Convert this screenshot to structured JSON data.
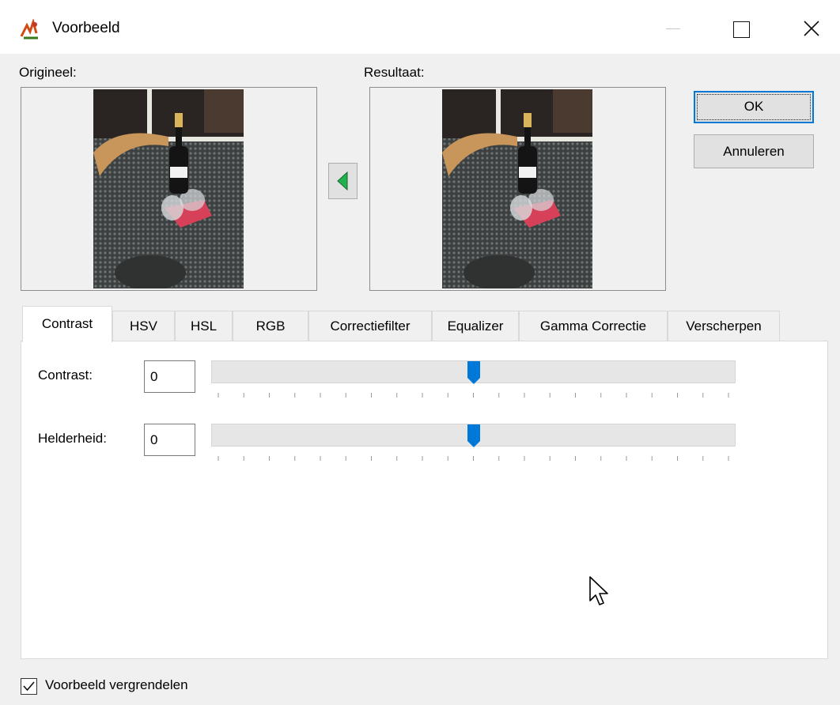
{
  "window": {
    "title": "Voorbeeld",
    "controls": [
      "minimize-icon",
      "maximize-icon",
      "close-icon"
    ]
  },
  "labels": {
    "original": "Origineel:",
    "result": "Resultaat:"
  },
  "buttons": {
    "ok": "OK",
    "cancel": "Annuleren",
    "copy_icon": "arrow-left-icon"
  },
  "tabs": [
    {
      "label": "Contrast",
      "active": true
    },
    {
      "label": "HSV",
      "active": false
    },
    {
      "label": "HSL",
      "active": false
    },
    {
      "label": "RGB",
      "active": false
    },
    {
      "label": "Correctiefilter",
      "active": false
    },
    {
      "label": "Equalizer",
      "active": false
    },
    {
      "label": "Gamma Correctie",
      "active": false
    },
    {
      "label": "Verscherpen",
      "active": false
    }
  ],
  "controls": [
    {
      "label": "Contrast:",
      "value": "0",
      "slider_level": 0.5
    },
    {
      "label": "Helderheid:",
      "value": "0",
      "slider_level": 0.5
    }
  ],
  "lock_preview": {
    "label": "Voorbeeld vergrendelen",
    "checked": true
  },
  "colors": {
    "accent": "#0078d7",
    "copy_arrow": "#22b14c"
  }
}
